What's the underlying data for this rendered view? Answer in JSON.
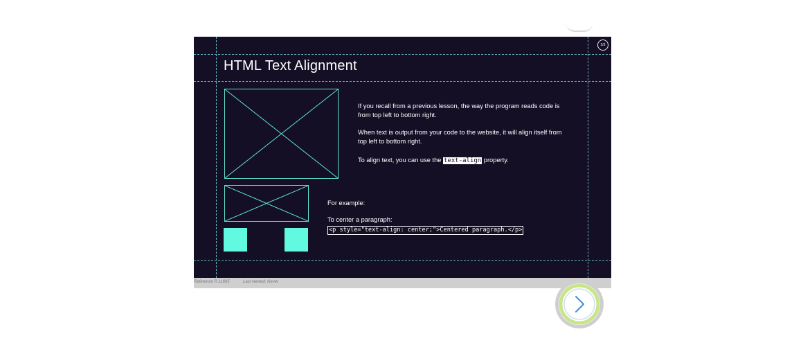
{
  "slide": {
    "page_counter": "2/3",
    "title": "HTML Text Alignment",
    "paragraphs": {
      "p1": "If you recall from a previous lesson, the way the program reads code is from top left to bottom right.",
      "p2": "When text is output from your code to the website, it will align itself from top left to bottom right.",
      "p3_before": "To align text, you can use the ",
      "p3_code": "text-align",
      "p3_after": " property.",
      "example_label": "For example:",
      "center_label": "To center a paragraph:",
      "code_example": "<p style=\"text-align: center;\">Centered paragraph.</p>"
    }
  },
  "footer": {
    "reference": "Reference R 11695",
    "last_viewed": "Last viewed: Never"
  },
  "colors": {
    "slide_bg": "#140f24",
    "accent": "#61f9e0",
    "guide": "#63b6c2",
    "progress_ring": "#c9e58a",
    "chevron": "#3d8fd6"
  },
  "icons": {
    "next": "chevron-right-icon"
  }
}
